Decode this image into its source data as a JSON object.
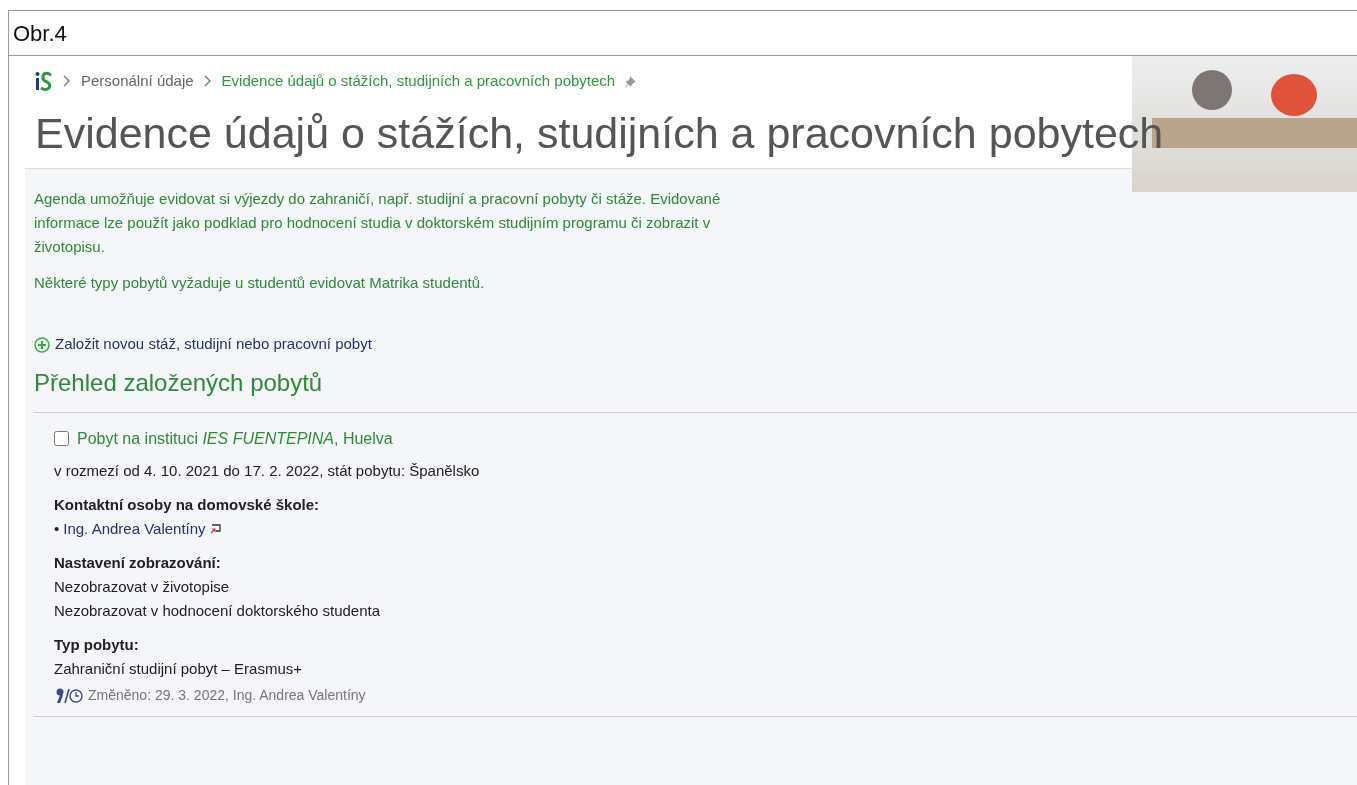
{
  "figure_caption": "Obr.4",
  "breadcrumb": [
    {
      "label": "Personální údaje",
      "current": false
    },
    {
      "label": "Evidence údajů o stážích, studijních a pracovních pobytech",
      "current": true
    }
  ],
  "page_title": "Evidence údajů o stážích, studijních a pracovních pobytech",
  "intro": [
    "Agenda umožňuje evidovat si výjezdy do zahraničí, např. studijní a pracovní pobyty či stáže. Evidované informace lze použít jako podklad pro hodnocení studia v doktorském studijním programu či zobrazit v životopisu.",
    "Některé typy pobytů vyžaduje u studentů evidovat Matrika studentů."
  ],
  "add_link": "Založit novou stáž, studijní nebo pracovní pobyt",
  "section_title": "Přehled založených pobytů",
  "stays": [
    {
      "checked": false,
      "title": "Pobyt na instituci *IES FUENTEPINA*, Huelva",
      "period": "v rozmezí od 4. 10. 2021 do 17. 2. 2022, stát pobytu: Španělsko",
      "contacts_label": "Kontaktní osoby na domovské škole:",
      "bullet": "•",
      "contacts": [
        "Ing. Andrea Valentíny"
      ],
      "display_label": "Nastavení zobrazování:",
      "display_settings": [
        "Nezobrazovat v životopise",
        "Nezobrazovat v hodnocení doktorského studenta"
      ],
      "type_label": "Typ pobytu:",
      "type": "Zahraniční studijní pobyt – Erasmus+",
      "changed": "Změněno: 29. 3. 2022, Ing. Andrea Valentíny"
    }
  ]
}
